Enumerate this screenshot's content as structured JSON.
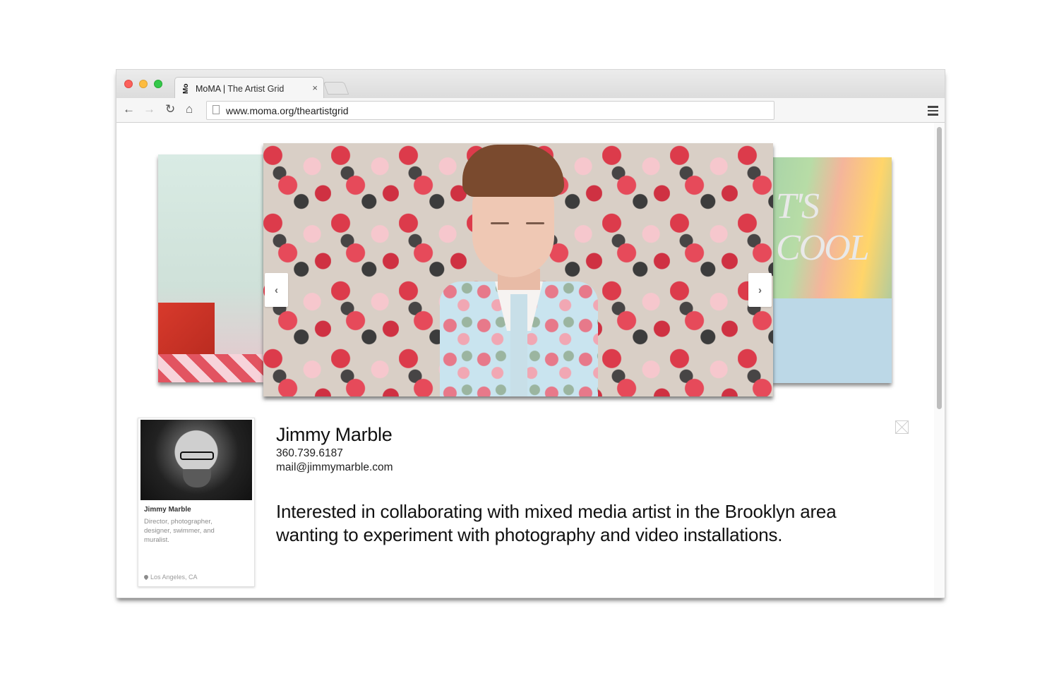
{
  "browser": {
    "tab_logo": "Mo",
    "tab_title": "MoMA",
    "tab_separator": "|",
    "tab_subtitle": "The Artist Grid",
    "tab_close": "×",
    "url": "www.moma.org/theartistgrid",
    "icons": [
      "back-arrow-icon",
      "forward-arrow-icon",
      "reload-icon",
      "home-icon",
      "page-icon",
      "menu-icon"
    ]
  },
  "carousel": {
    "right_slide_text": "T'S COOL",
    "prev_label": "‹",
    "next_label": "›"
  },
  "profile_card": {
    "name": "Jimmy Marble",
    "description": "Director, photographer, designer, swimmer, and muralist.",
    "location": "Los Angeles, CA"
  },
  "artist": {
    "name": "Jimmy Marble",
    "phone": "360.739.6187",
    "email": "mail@jimmymarble.com",
    "bio": "Interested in collaborating with mixed media artist in the Brooklyn area wanting to experiment with photography and video installations."
  },
  "colors": {
    "close_red": "#fc605b",
    "minimize_yellow": "#fdbc40",
    "zoom_green": "#34c84a"
  }
}
